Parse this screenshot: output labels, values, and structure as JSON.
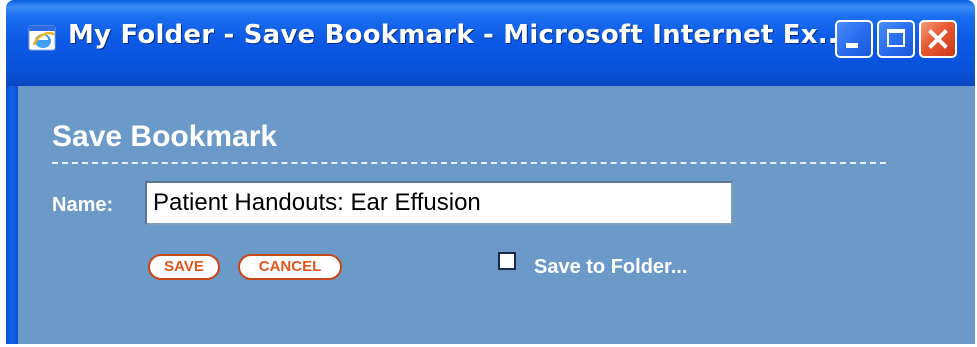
{
  "window": {
    "title": "My Folder - Save Bookmark - Microsoft Internet Ex...",
    "icon": "internet-explorer-icon",
    "controls": {
      "minimize": "minimize-icon",
      "maximize": "maximize-icon",
      "close": "close-icon"
    },
    "title_bar_color": "#0a55de",
    "close_color": "#e8582f"
  },
  "dialog": {
    "heading": "Save Bookmark",
    "name_label": "Name:",
    "name_value": "Patient Handouts: Ear Effusion",
    "save_label": "SAVE",
    "cancel_label": "CANCEL",
    "folder_option_label": "Save to Folder...",
    "folder_option_checked": false,
    "background_color": "#6b9ac8",
    "button_accent_color": "#e2561c"
  }
}
